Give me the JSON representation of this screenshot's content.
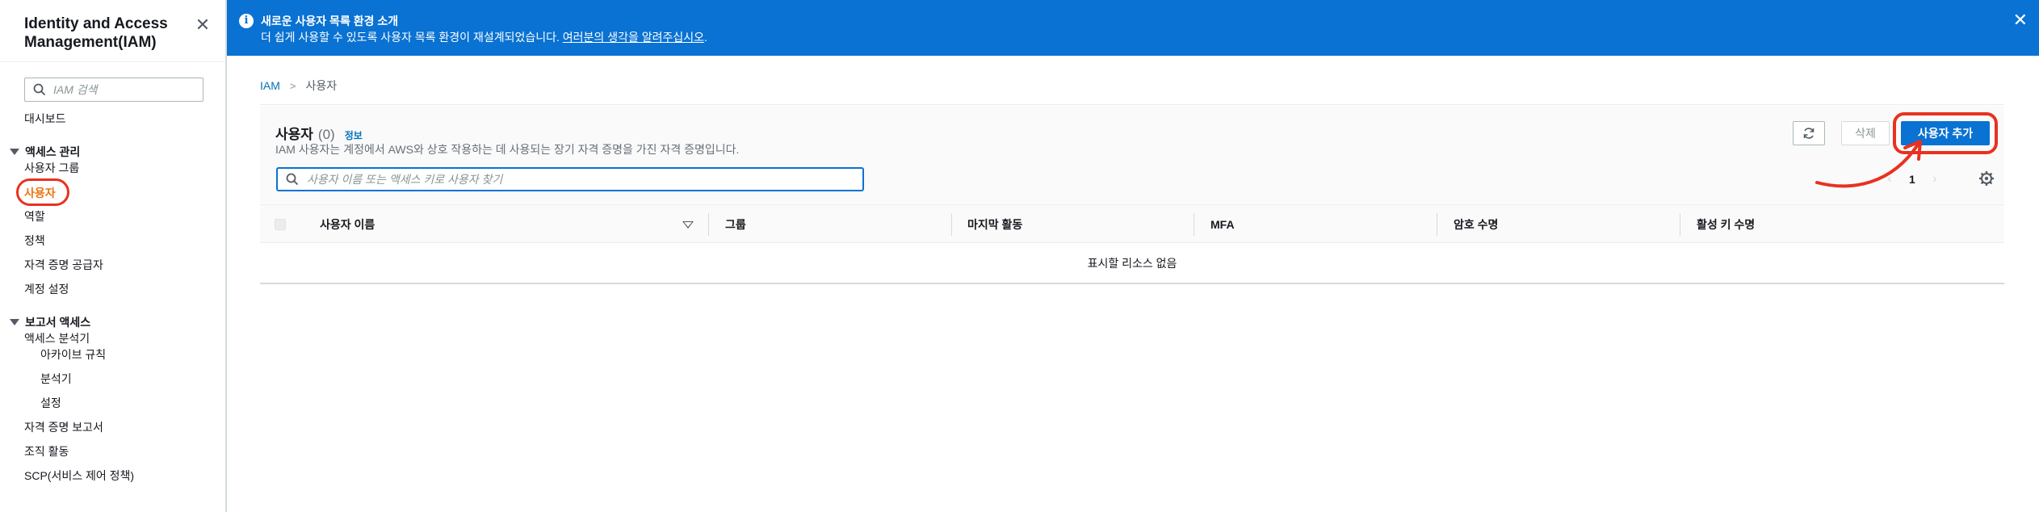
{
  "sidebar": {
    "title": "Identity and Access Management(IAM)",
    "search_placeholder": "IAM 검색",
    "dashboard": "대시보드",
    "access_mgmt": {
      "label": "액세스 관리",
      "items": [
        "사용자 그룹",
        "사용자",
        "역할",
        "정책",
        "자격 증명 공급자",
        "계정 설정"
      ]
    },
    "access_reports": {
      "label": "보고서 액세스",
      "analyzer": "액세스 분석기",
      "analyzer_items": [
        "아카이브 규칙",
        "분석기",
        "설정"
      ],
      "items": [
        "자격 증명 보고서",
        "조직 활동",
        "SCP(서비스 제어 정책)"
      ]
    }
  },
  "banner": {
    "title": "새로운 사용자 목록 환경 소개",
    "text": "더 쉽게 사용할 수 있도록 사용자 목록 환경이 재설계되었습니다.",
    "link": "여러분의 생각을 알려주십시오",
    "link_suffix": "."
  },
  "breadcrumb": {
    "root": "IAM",
    "current": "사용자"
  },
  "panel": {
    "title": "사용자",
    "count": "(0)",
    "info": "정보",
    "description": "IAM 사용자는 계정에서 AWS와 상호 작용하는 데 사용되는 장기 자격 증명을 가진 자격 증명입니다.",
    "delete_label": "삭제",
    "add_label": "사용자 추가",
    "search_placeholder": "사용자 이름 또는 액세스 키로 사용자 찾기",
    "page": "1"
  },
  "table": {
    "columns": [
      "사용자 이름",
      "그룹",
      "마지막 활동",
      "MFA",
      "암호 수명",
      "활성 키 수명"
    ],
    "empty": "표시할 리소스 없음"
  },
  "colors": {
    "accent": "#0972d3",
    "active_nav": "#ec7211",
    "highlight": "#e8321f"
  }
}
